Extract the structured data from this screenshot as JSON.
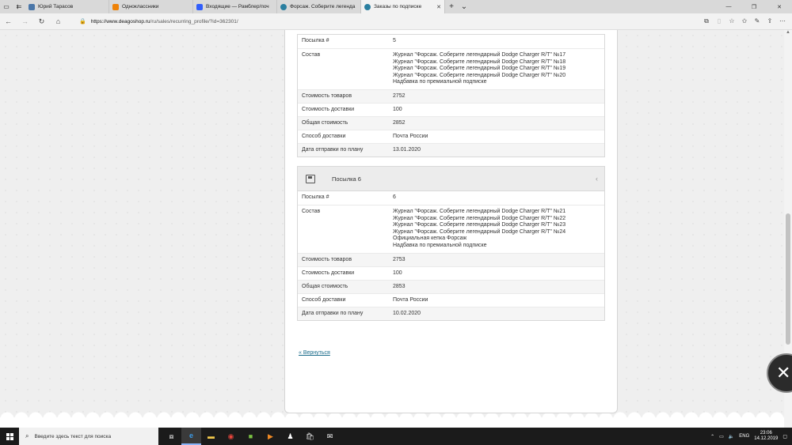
{
  "browser": {
    "tabs": [
      {
        "title": "Юрий Тарасов",
        "fav_color": "#4a76a8"
      },
      {
        "title": "Одноклассники",
        "fav_color": "#ee8208"
      },
      {
        "title": "Входящие — Рамблер/поч",
        "fav_color": "#315efb"
      },
      {
        "title": "Форсаж. Соберите легенда",
        "fav_color": "#2a7fa0"
      },
      {
        "title": "Заказы по подписке",
        "fav_color": "#2a7fa0"
      }
    ],
    "url_host": "https://www.deagoshop.ru",
    "url_path": "/ru/sales/recurring_profile/?id=362301/"
  },
  "parcel5": {
    "rows": [
      {
        "label": "Посылка #",
        "value": "5"
      },
      {
        "label": "Состав",
        "lines": [
          "Журнал \"Форсаж. Соберите легендарный Dodge Charger R/T\" №17",
          "Журнал \"Форсаж. Соберите легендарный Dodge Charger R/T\" №18",
          "Журнал \"Форсаж. Соберите легендарный Dodge Charger R/T\" №19",
          "Журнал \"Форсаж. Соберите легендарный Dodge Charger R/T\" №20",
          "Надбавка по премиальной подписке"
        ]
      },
      {
        "label": "Стоимость товаров",
        "value": "2752"
      },
      {
        "label": "Стоимость доставки",
        "value": "100"
      },
      {
        "label": "Общая стоимость",
        "value": "2852"
      },
      {
        "label": "Способ доставки",
        "value": "Почта России"
      },
      {
        "label": "Дата отправки по плану",
        "value": "13.01.2020"
      }
    ]
  },
  "parcel6": {
    "title": "Посылка 6",
    "rows": [
      {
        "label": "Посылка #",
        "value": "6"
      },
      {
        "label": "Состав",
        "lines": [
          "Журнал \"Форсаж. Соберите легендарный Dodge Charger R/T\" №21",
          "Журнал \"Форсаж. Соберите легендарный Dodge Charger R/T\" №22",
          "Журнал \"Форсаж. Соберите легендарный Dodge Charger R/T\" №23",
          "Журнал \"Форсаж. Соберите легендарный Dodge Charger R/T\" №24",
          "Официальная кепка Форсаж",
          "Надбавка по премиальной подписке"
        ]
      },
      {
        "label": "Стоимость товаров",
        "value": "2753"
      },
      {
        "label": "Стоимость доставки",
        "value": "100"
      },
      {
        "label": "Общая стоимость",
        "value": "2853"
      },
      {
        "label": "Способ доставки",
        "value": "Почта России"
      },
      {
        "label": "Дата отправки по плану",
        "value": "10.02.2020"
      }
    ]
  },
  "back_link": "« Вернуться",
  "taskbar": {
    "search_placeholder": "Введите здесь текст для поиска",
    "lang": "ENG",
    "time": "23:06",
    "date": "14.12.2019"
  }
}
